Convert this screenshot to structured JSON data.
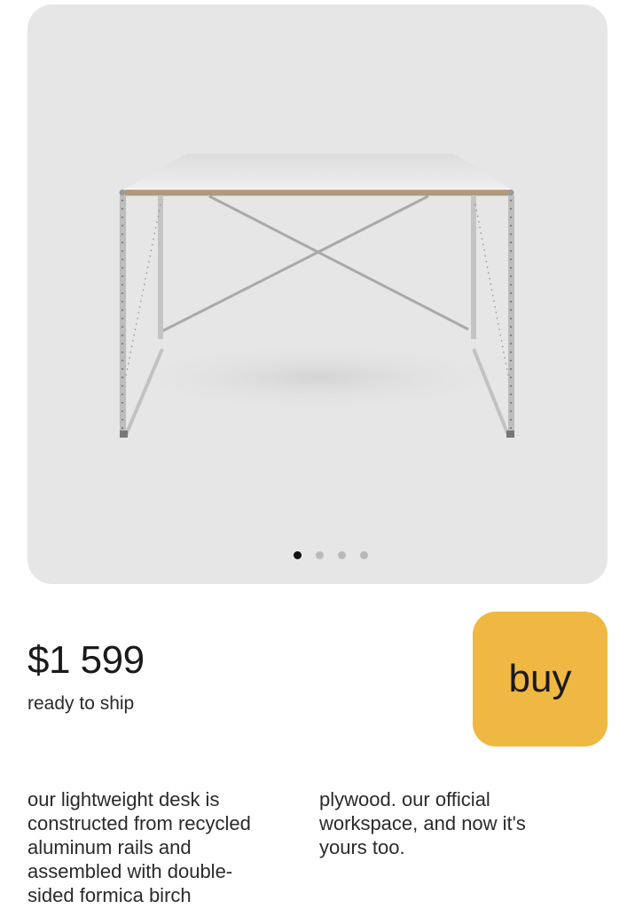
{
  "gallery": {
    "image_alt": "aluminum desk with white formica birch plywood top",
    "slide_count": 4,
    "active_slide": 1,
    "background": "#e6e6e6"
  },
  "product": {
    "price": "$1 599",
    "availability": "ready to ship"
  },
  "buy_button": {
    "label": "buy",
    "color": "#efb843"
  },
  "description": {
    "column1_lines": [
      "our lightweight desk is",
      "constructed from recycled",
      "aluminum rails and",
      "assembled with double-",
      "sided formica birch"
    ],
    "column2_lines": [
      "plywood. our official",
      "workspace, and now it's",
      "yours too."
    ]
  }
}
